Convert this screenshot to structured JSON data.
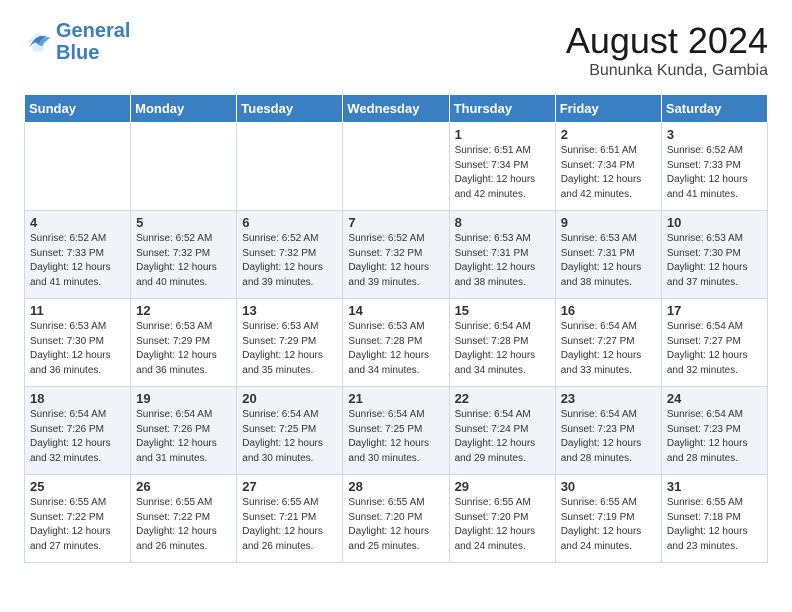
{
  "header": {
    "logo_line1": "General",
    "logo_line2": "Blue",
    "main_title": "August 2024",
    "sub_title": "Bununka Kunda, Gambia"
  },
  "days_of_week": [
    "Sunday",
    "Monday",
    "Tuesday",
    "Wednesday",
    "Thursday",
    "Friday",
    "Saturday"
  ],
  "weeks": [
    [
      {
        "day": "",
        "info": ""
      },
      {
        "day": "",
        "info": ""
      },
      {
        "day": "",
        "info": ""
      },
      {
        "day": "",
        "info": ""
      },
      {
        "day": "1",
        "info": "Sunrise: 6:51 AM\nSunset: 7:34 PM\nDaylight: 12 hours\nand 42 minutes."
      },
      {
        "day": "2",
        "info": "Sunrise: 6:51 AM\nSunset: 7:34 PM\nDaylight: 12 hours\nand 42 minutes."
      },
      {
        "day": "3",
        "info": "Sunrise: 6:52 AM\nSunset: 7:33 PM\nDaylight: 12 hours\nand 41 minutes."
      }
    ],
    [
      {
        "day": "4",
        "info": "Sunrise: 6:52 AM\nSunset: 7:33 PM\nDaylight: 12 hours\nand 41 minutes."
      },
      {
        "day": "5",
        "info": "Sunrise: 6:52 AM\nSunset: 7:32 PM\nDaylight: 12 hours\nand 40 minutes."
      },
      {
        "day": "6",
        "info": "Sunrise: 6:52 AM\nSunset: 7:32 PM\nDaylight: 12 hours\nand 39 minutes."
      },
      {
        "day": "7",
        "info": "Sunrise: 6:52 AM\nSunset: 7:32 PM\nDaylight: 12 hours\nand 39 minutes."
      },
      {
        "day": "8",
        "info": "Sunrise: 6:53 AM\nSunset: 7:31 PM\nDaylight: 12 hours\nand 38 minutes."
      },
      {
        "day": "9",
        "info": "Sunrise: 6:53 AM\nSunset: 7:31 PM\nDaylight: 12 hours\nand 38 minutes."
      },
      {
        "day": "10",
        "info": "Sunrise: 6:53 AM\nSunset: 7:30 PM\nDaylight: 12 hours\nand 37 minutes."
      }
    ],
    [
      {
        "day": "11",
        "info": "Sunrise: 6:53 AM\nSunset: 7:30 PM\nDaylight: 12 hours\nand 36 minutes."
      },
      {
        "day": "12",
        "info": "Sunrise: 6:53 AM\nSunset: 7:29 PM\nDaylight: 12 hours\nand 36 minutes."
      },
      {
        "day": "13",
        "info": "Sunrise: 6:53 AM\nSunset: 7:29 PM\nDaylight: 12 hours\nand 35 minutes."
      },
      {
        "day": "14",
        "info": "Sunrise: 6:53 AM\nSunset: 7:28 PM\nDaylight: 12 hours\nand 34 minutes."
      },
      {
        "day": "15",
        "info": "Sunrise: 6:54 AM\nSunset: 7:28 PM\nDaylight: 12 hours\nand 34 minutes."
      },
      {
        "day": "16",
        "info": "Sunrise: 6:54 AM\nSunset: 7:27 PM\nDaylight: 12 hours\nand 33 minutes."
      },
      {
        "day": "17",
        "info": "Sunrise: 6:54 AM\nSunset: 7:27 PM\nDaylight: 12 hours\nand 32 minutes."
      }
    ],
    [
      {
        "day": "18",
        "info": "Sunrise: 6:54 AM\nSunset: 7:26 PM\nDaylight: 12 hours\nand 32 minutes."
      },
      {
        "day": "19",
        "info": "Sunrise: 6:54 AM\nSunset: 7:26 PM\nDaylight: 12 hours\nand 31 minutes."
      },
      {
        "day": "20",
        "info": "Sunrise: 6:54 AM\nSunset: 7:25 PM\nDaylight: 12 hours\nand 30 minutes."
      },
      {
        "day": "21",
        "info": "Sunrise: 6:54 AM\nSunset: 7:25 PM\nDaylight: 12 hours\nand 30 minutes."
      },
      {
        "day": "22",
        "info": "Sunrise: 6:54 AM\nSunset: 7:24 PM\nDaylight: 12 hours\nand 29 minutes."
      },
      {
        "day": "23",
        "info": "Sunrise: 6:54 AM\nSunset: 7:23 PM\nDaylight: 12 hours\nand 28 minutes."
      },
      {
        "day": "24",
        "info": "Sunrise: 6:54 AM\nSunset: 7:23 PM\nDaylight: 12 hours\nand 28 minutes."
      }
    ],
    [
      {
        "day": "25",
        "info": "Sunrise: 6:55 AM\nSunset: 7:22 PM\nDaylight: 12 hours\nand 27 minutes."
      },
      {
        "day": "26",
        "info": "Sunrise: 6:55 AM\nSunset: 7:22 PM\nDaylight: 12 hours\nand 26 minutes."
      },
      {
        "day": "27",
        "info": "Sunrise: 6:55 AM\nSunset: 7:21 PM\nDaylight: 12 hours\nand 26 minutes."
      },
      {
        "day": "28",
        "info": "Sunrise: 6:55 AM\nSunset: 7:20 PM\nDaylight: 12 hours\nand 25 minutes."
      },
      {
        "day": "29",
        "info": "Sunrise: 6:55 AM\nSunset: 7:20 PM\nDaylight: 12 hours\nand 24 minutes."
      },
      {
        "day": "30",
        "info": "Sunrise: 6:55 AM\nSunset: 7:19 PM\nDaylight: 12 hours\nand 24 minutes."
      },
      {
        "day": "31",
        "info": "Sunrise: 6:55 AM\nSunset: 7:18 PM\nDaylight: 12 hours\nand 23 minutes."
      }
    ]
  ]
}
